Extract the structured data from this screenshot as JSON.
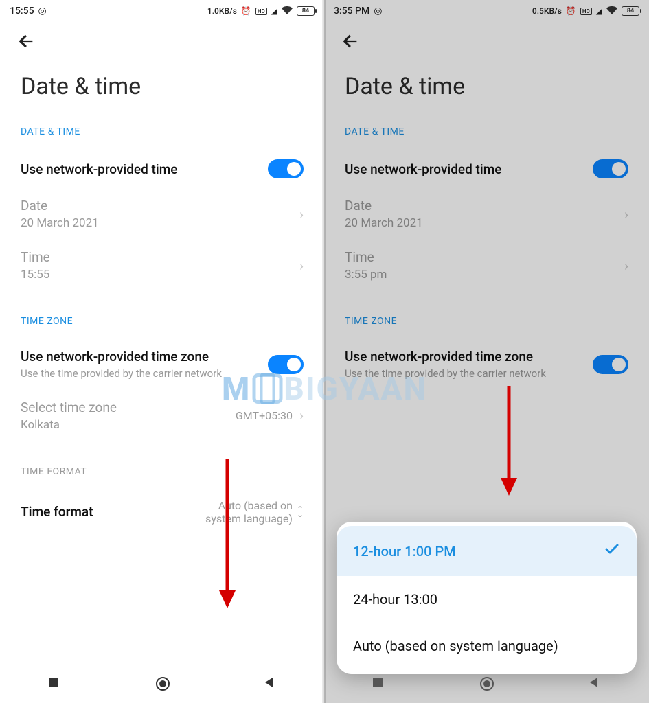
{
  "watermark": "MOBIGYAAN",
  "left": {
    "status": {
      "time": "15:55",
      "speed": "1.0KB/s",
      "battery_text": "84"
    },
    "page_title": "Date & time",
    "sections": {
      "date_time": {
        "label": "DATE & TIME",
        "use_network_time": "Use network-provided time",
        "date_label": "Date",
        "date_value": "20 March 2021",
        "time_label": "Time",
        "time_value": "15:55"
      },
      "time_zone": {
        "label": "TIME ZONE",
        "use_network_zone": "Use network-provided time zone",
        "use_network_zone_desc": "Use the time provided by the carrier network",
        "select_tz": "Select time zone",
        "select_tz_value": "Kolkata",
        "select_tz_offset": "GMT+05:30"
      },
      "time_format": {
        "label": "TIME FORMAT",
        "row_title": "Time format",
        "row_value_l1": "Auto (based on",
        "row_value_l2": "system language)"
      }
    }
  },
  "right": {
    "status": {
      "time": "3:55 PM",
      "speed": "0.5KB/s",
      "battery_text": "84"
    },
    "page_title": "Date & time",
    "sections": {
      "date_time": {
        "label": "DATE & TIME",
        "use_network_time": "Use network-provided time",
        "date_label": "Date",
        "date_value": "20 March 2021",
        "time_label": "Time",
        "time_value": "3:55 pm"
      },
      "time_zone": {
        "label": "TIME ZONE",
        "use_network_zone": "Use network-provided time zone",
        "use_network_zone_desc": "Use the time provided by the carrier network"
      }
    },
    "sheet": {
      "opt1": "12-hour 1:00 PM",
      "opt2": "24-hour 13:00",
      "opt3": "Auto (based on system language)"
    }
  }
}
